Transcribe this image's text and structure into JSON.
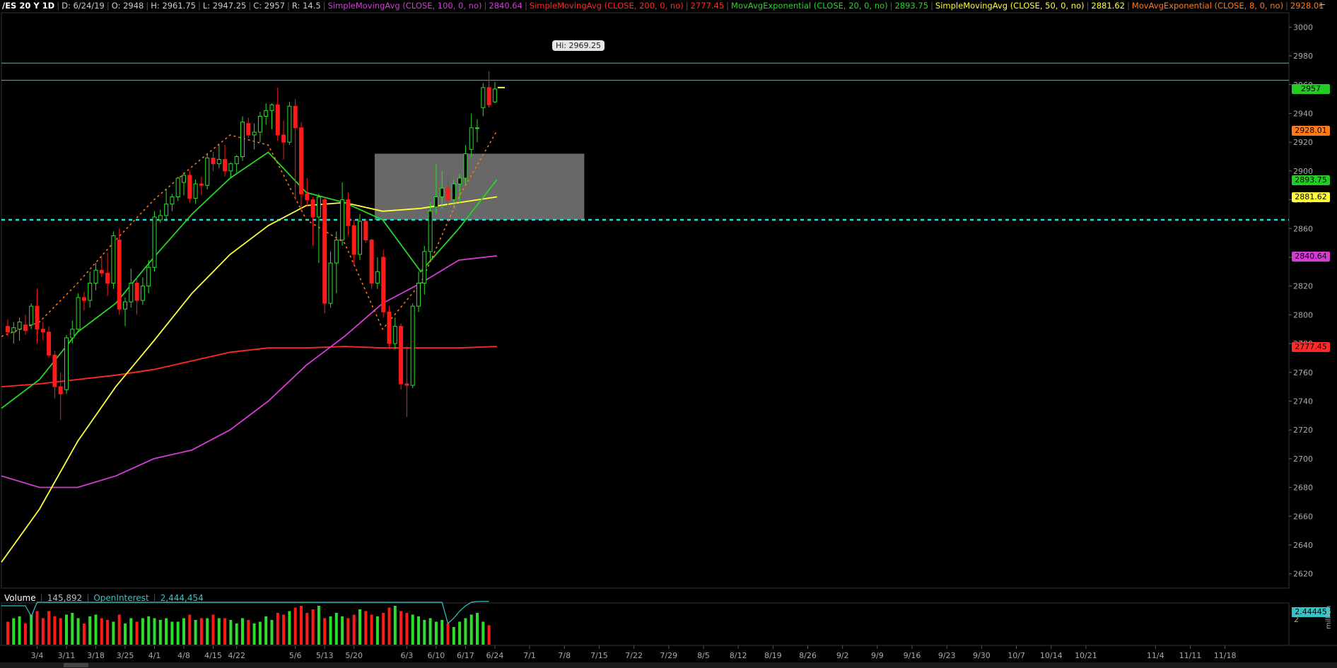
{
  "header": {
    "symbol": "/ES 20 Y 1D",
    "date": "D: 6/24/19",
    "open": "O: 2948",
    "high": "H: 2961.75",
    "low": "L: 2947.25",
    "close": "C: 2957",
    "range": "R: 14.5",
    "studies": [
      {
        "label": "SimpleMovingAvg (CLOSE, 100, 0, no)",
        "value": "2840.64",
        "color": "#d63bd6"
      },
      {
        "label": "SimpleMovingAvg (CLOSE, 200, 0, no)",
        "value": "2777.45",
        "color": "#ff2a2a"
      },
      {
        "label": "MovAvgExponential (CLOSE, 20, 0, no)",
        "value": "2893.75",
        "color": "#28d428"
      },
      {
        "label": "SimpleMovingAvg (CLOSE, 50, 0, no)",
        "value": "2881.62",
        "color": "#ffff3a"
      },
      {
        "label": "MovAvgExponential (CLOSE, 8, 0, no)",
        "value": "2928.01",
        "color": "#ff7a1a"
      }
    ]
  },
  "hi_label": "Hi: 2969.25",
  "price_tags": [
    {
      "value": "2957",
      "price": 2957,
      "bg": "#22cc22"
    },
    {
      "value": "2928.01",
      "price": 2928.01,
      "bg": "#ff7a1a"
    },
    {
      "value": "2893.75",
      "price": 2893.75,
      "bg": "#22cc22"
    },
    {
      "value": "2881.62",
      "price": 2881.62,
      "bg": "#ffff3a"
    },
    {
      "value": "2840.64",
      "price": 2840.64,
      "bg": "#d63bd6"
    },
    {
      "value": "2777.45",
      "price": 2777.45,
      "bg": "#ff2a2a"
    }
  ],
  "volume_header": {
    "volume_label": "Volume",
    "volume_value": "145,892",
    "oi_label": "OpenInterest",
    "oi_value": "2,444,454"
  },
  "volume_tag": "2.44445",
  "volume_scale_label": "2",
  "volume_unit": "million",
  "chart_data": {
    "type": "candlestick",
    "price_axis": {
      "range": [
        2610,
        3010
      ],
      "ticks": [
        2620,
        2640,
        2660,
        2680,
        2700,
        2720,
        2740,
        2760,
        2780,
        2800,
        2820,
        2840,
        2860,
        2880,
        2900,
        2920,
        2940,
        2960,
        2980,
        3000
      ]
    },
    "date_ticks": [
      "3/4",
      "3/11",
      "3/18",
      "3/25",
      "4/1",
      "4/8",
      "4/15",
      "4/22",
      "5/6",
      "5/13",
      "5/20",
      "6/3",
      "6/10",
      "6/17",
      "6/24",
      "7/1",
      "7/8",
      "7/15",
      "7/22",
      "7/29",
      "8/5",
      "8/12",
      "8/19",
      "8/26",
      "9/2",
      "9/9",
      "9/16",
      "9/23",
      "9/30",
      "10/7",
      "10/14",
      "10/21",
      "11/4",
      "11/11",
      "11/18"
    ],
    "horizontal_lines": [
      {
        "price": 2975,
        "style": "solid",
        "color": "#2ec6c6"
      },
      {
        "price": 2963,
        "style": "solid",
        "color": "#2ec6c6"
      },
      {
        "price": 2866,
        "style": "dashed",
        "color": "#22e0e0"
      }
    ],
    "zone": {
      "from_date": "5/24",
      "to_date": "7/12",
      "low": 2866,
      "high": 2912,
      "color": "#7a7a7a"
    },
    "candles": [
      [
        "2/25",
        2792,
        2797,
        2785,
        2788
      ],
      [
        "2/26",
        2788,
        2795,
        2780,
        2791
      ],
      [
        "2/27",
        2790,
        2798,
        2782,
        2795
      ],
      [
        "2/28",
        2793,
        2800,
        2786,
        2789
      ],
      [
        "3/1",
        2793,
        2808,
        2790,
        2806
      ],
      [
        "3/4",
        2806,
        2818,
        2780,
        2790
      ],
      [
        "3/5",
        2790,
        2795,
        2782,
        2788
      ],
      [
        "3/6",
        2788,
        2792,
        2770,
        2772
      ],
      [
        "3/7",
        2772,
        2775,
        2742,
        2750
      ],
      [
        "3/8",
        2750,
        2760,
        2727,
        2745
      ],
      [
        "3/11",
        2748,
        2786,
        2745,
        2784
      ],
      [
        "3/12",
        2784,
        2796,
        2780,
        2790
      ],
      [
        "3/13",
        2790,
        2815,
        2788,
        2812
      ],
      [
        "3/14",
        2812,
        2816,
        2803,
        2810
      ],
      [
        "3/15",
        2810,
        2830,
        2805,
        2822
      ],
      [
        "3/18",
        2822,
        2836,
        2817,
        2831
      ],
      [
        "3/19",
        2831,
        2841,
        2826,
        2829
      ],
      [
        "3/20",
        2829,
        2843,
        2813,
        2822
      ],
      [
        "3/21",
        2822,
        2858,
        2818,
        2855
      ],
      [
        "3/22",
        2852,
        2860,
        2800,
        2804
      ],
      [
        "3/25",
        2804,
        2812,
        2792,
        2809
      ],
      [
        "3/26",
        2809,
        2832,
        2805,
        2822
      ],
      [
        "3/27",
        2822,
        2826,
        2800,
        2810
      ],
      [
        "3/28",
        2810,
        2826,
        2807,
        2820
      ],
      [
        "3/29",
        2820,
        2838,
        2815,
        2833
      ],
      [
        "4/1",
        2833,
        2872,
        2830,
        2868
      ],
      [
        "4/2",
        2866,
        2873,
        2864,
        2869
      ],
      [
        "4/3",
        2869,
        2887,
        2865,
        2877
      ],
      [
        "4/4",
        2877,
        2884,
        2872,
        2882
      ],
      [
        "4/5",
        2882,
        2896,
        2879,
        2895
      ],
      [
        "4/8",
        2892,
        2899,
        2883,
        2897
      ],
      [
        "4/9",
        2897,
        2900,
        2878,
        2881
      ],
      [
        "4/10",
        2881,
        2894,
        2877,
        2891
      ],
      [
        "4/11",
        2891,
        2896,
        2883,
        2890
      ],
      [
        "4/12",
        2890,
        2912,
        2887,
        2909
      ],
      [
        "4/15",
        2909,
        2913,
        2900,
        2905
      ],
      [
        "4/16",
        2905,
        2918,
        2902,
        2908
      ],
      [
        "4/17",
        2908,
        2918,
        2896,
        2900
      ],
      [
        "4/18",
        2900,
        2906,
        2895,
        2905
      ],
      [
        "4/22",
        2905,
        2911,
        2899,
        2910
      ],
      [
        "4/23",
        2910,
        2938,
        2907,
        2934
      ],
      [
        "4/24",
        2933,
        2937,
        2923,
        2925
      ],
      [
        "4/25",
        2925,
        2933,
        2915,
        2927
      ],
      [
        "4/26",
        2927,
        2941,
        2920,
        2938
      ],
      [
        "4/29",
        2938,
        2947,
        2932,
        2942
      ],
      [
        "4/30",
        2942,
        2947,
        2929,
        2946
      ],
      [
        "5/1",
        2946,
        2958,
        2921,
        2925
      ],
      [
        "5/2",
        2925,
        2935,
        2908,
        2920
      ],
      [
        "5/3",
        2920,
        2948,
        2918,
        2945
      ],
      [
        "5/6",
        2945,
        2950,
        2880,
        2930
      ],
      [
        "5/7",
        2930,
        2934,
        2872,
        2884
      ],
      [
        "5/8",
        2884,
        2895,
        2875,
        2880
      ],
      [
        "5/9",
        2880,
        2882,
        2848,
        2868
      ],
      [
        "5/10",
        2868,
        2884,
        2836,
        2882
      ],
      [
        "5/13",
        2880,
        2882,
        2801,
        2808
      ],
      [
        "5/14",
        2808,
        2844,
        2805,
        2836
      ],
      [
        "5/15",
        2836,
        2858,
        2815,
        2852
      ],
      [
        "5/16",
        2852,
        2892,
        2848,
        2880
      ],
      [
        "5/17",
        2880,
        2885,
        2855,
        2862
      ],
      [
        "5/20",
        2862,
        2866,
        2834,
        2842
      ],
      [
        "5/21",
        2842,
        2870,
        2838,
        2865
      ],
      [
        "5/22",
        2865,
        2867,
        2850,
        2852
      ],
      [
        "5/23",
        2852,
        2853,
        2818,
        2822
      ],
      [
        "5/24",
        2822,
        2840,
        2818,
        2830
      ],
      [
        "5/28",
        2840,
        2845,
        2798,
        2802
      ],
      [
        "5/29",
        2802,
        2806,
        2777,
        2780
      ],
      [
        "5/30",
        2780,
        2798,
        2776,
        2792
      ],
      [
        "5/31",
        2792,
        2794,
        2748,
        2752
      ],
      [
        "6/3",
        2752,
        2778,
        2729,
        2751
      ],
      [
        "6/4",
        2751,
        2808,
        2749,
        2806
      ],
      [
        "6/5",
        2806,
        2830,
        2802,
        2822
      ],
      [
        "6/6",
        2822,
        2848,
        2814,
        2844
      ],
      [
        "6/7",
        2844,
        2878,
        2838,
        2872
      ],
      [
        "6/10",
        2875,
        2905,
        2870,
        2882
      ],
      [
        "6/11",
        2882,
        2900,
        2874,
        2888
      ],
      [
        "6/12",
        2888,
        2896,
        2876,
        2880
      ],
      [
        "6/13",
        2880,
        2894,
        2874,
        2891
      ],
      [
        "6/14",
        2891,
        2898,
        2878,
        2895
      ],
      [
        "6/17",
        2895,
        2918,
        2891,
        2912
      ],
      [
        "6/18",
        2915,
        2940,
        2910,
        2930
      ],
      [
        "6/19",
        2930,
        2936,
        2920,
        2930
      ],
      [
        "6/20",
        2944,
        2961,
        2938,
        2958
      ],
      [
        "6/21",
        2958,
        2969.25,
        2944,
        2946
      ],
      [
        "6/24",
        2948,
        2961.75,
        2947.25,
        2957
      ]
    ],
    "series": [
      {
        "name": "SimpleMovingAvg (CLOSE, 200, 0, no)",
        "color": "#ff2a2a",
        "style": "solid",
        "values": [
          2750,
          2752,
          2755,
          2758,
          2762,
          2768,
          2774,
          2777,
          2777,
          2778,
          2777,
          2777,
          2777,
          2778
        ]
      },
      {
        "name": "SimpleMovingAvg (CLOSE, 100, 0, no)",
        "color": "#d63bd6",
        "style": "solid",
        "values": [
          2688,
          2680,
          2680,
          2688,
          2700,
          2706,
          2720,
          2740,
          2765,
          2785,
          2808,
          2822,
          2838,
          2841
        ]
      },
      {
        "name": "SimpleMovingAvg (CLOSE, 50, 0, no)",
        "color": "#ffff3a",
        "style": "solid",
        "values": [
          2628,
          2665,
          2712,
          2750,
          2782,
          2815,
          2842,
          2862,
          2876,
          2878,
          2872,
          2874,
          2878,
          2882
        ]
      },
      {
        "name": "MovAvgExponential (CLOSE, 20, 0, no)",
        "color": "#28d428",
        "style": "solid",
        "values": [
          2735,
          2755,
          2788,
          2808,
          2840,
          2870,
          2895,
          2913,
          2885,
          2878,
          2866,
          2830,
          2860,
          2894
        ]
      },
      {
        "name": "MovAvgExponential (CLOSE, 8, 0, no)",
        "color": "#ff7a1a",
        "style": "dashed",
        "values": [
          2785,
          2795,
          2822,
          2852,
          2880,
          2903,
          2925,
          2918,
          2866,
          2850,
          2790,
          2822,
          2882,
          2928
        ]
      }
    ],
    "volume": {
      "values": [
        1.3,
        1.5,
        1.6,
        1.2,
        1.7,
        1.9,
        1.5,
        1.9,
        1.6,
        1.5,
        1.7,
        1.8,
        1.5,
        1.2,
        1.6,
        1.7,
        1.5,
        1.4,
        1.3,
        1.7,
        1.2,
        1.5,
        1.3,
        1.5,
        1.6,
        1.5,
        1.4,
        1.5,
        1.3,
        1.3,
        1.5,
        1.7,
        1.4,
        1.5,
        1.5,
        1.7,
        1.5,
        1.5,
        1.4,
        1.2,
        1.5,
        1.4,
        1.2,
        1.3,
        1.6,
        1.4,
        1.8,
        1.7,
        1.9,
        2.1,
        2.2,
        1.8,
        2.0,
        2.2,
        1.5,
        1.6,
        1.8,
        1.6,
        1.5,
        1.7,
        2.0,
        1.9,
        1.7,
        1.6,
        1.8,
        2.1,
        2.2,
        1.9,
        1.8,
        1.7,
        1.6,
        1.4,
        1.5,
        1.3,
        1.4,
        1.2,
        1.0,
        1.3,
        1.5,
        1.7,
        1.8,
        1.3,
        1.1
      ],
      "open_interest": [
        2.2,
        2.2,
        2.2,
        2.2,
        1.6,
        2.4,
        2.4,
        2.4,
        2.4,
        2.4,
        2.4,
        2.4,
        2.4,
        2.4,
        2.4,
        2.4,
        2.4,
        2.4,
        2.4,
        2.4,
        2.4,
        2.4,
        2.4,
        2.4,
        2.4,
        2.4,
        2.4,
        2.4,
        2.4,
        2.4,
        2.4,
        2.4,
        2.4,
        2.4,
        2.4,
        2.4,
        2.4,
        2.4,
        2.4,
        2.4,
        2.4,
        2.4,
        2.4,
        2.4,
        2.4,
        2.4,
        2.4,
        2.4,
        2.4,
        2.4,
        2.4,
        2.4,
        2.4,
        2.4,
        2.4,
        2.4,
        2.4,
        2.4,
        2.4,
        2.4,
        2.4,
        2.4,
        2.4,
        2.4,
        2.4,
        2.4,
        2.4,
        2.4,
        2.4,
        2.4,
        2.4,
        2.4,
        2.4,
        2.4,
        2.4,
        1.2,
        1.5,
        1.9,
        2.2,
        2.4,
        2.44,
        2.44445,
        2.44445
      ]
    }
  }
}
